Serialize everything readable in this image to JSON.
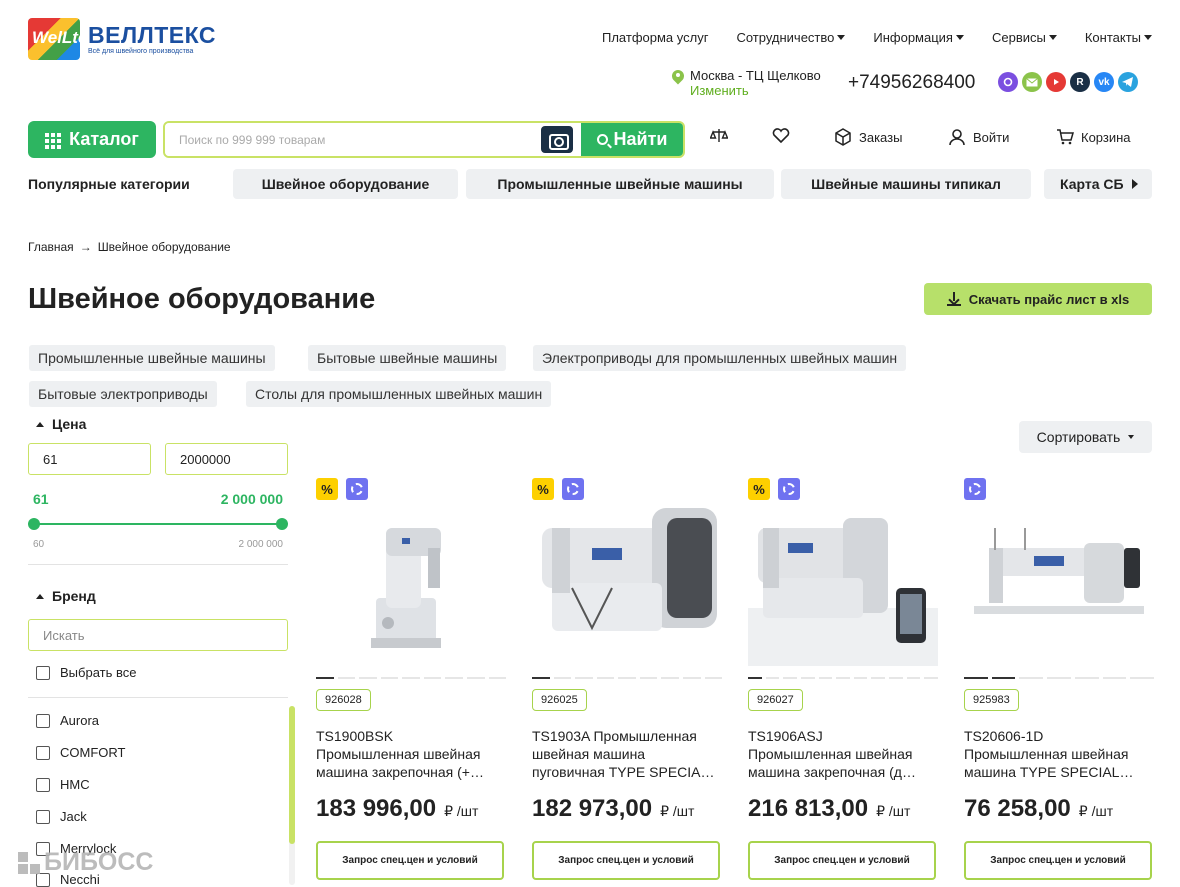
{
  "brand": {
    "logo_mark": "WelLtex",
    "name": "ВЕЛЛТЕКС",
    "tagline": "Всё для швейного производства"
  },
  "topnav": [
    {
      "label": "Платформа услуг",
      "dropdown": false
    },
    {
      "label": "Сотрудничество",
      "dropdown": true
    },
    {
      "label": "Информация",
      "dropdown": true
    },
    {
      "label": "Сервисы",
      "dropdown": true
    },
    {
      "label": "Контакты",
      "dropdown": true
    }
  ],
  "location": {
    "city": "Москва - ТЦ Щелково",
    "change": "Изменить"
  },
  "phone": "+74956268400",
  "socials": [
    {
      "icon": "max-icon",
      "color": "#7b4fe0"
    },
    {
      "icon": "mail-icon",
      "color": "#8bc34a"
    },
    {
      "icon": "youtube-icon",
      "color": "#e53935"
    },
    {
      "icon": "rutube-icon",
      "color": "#1a2f45"
    },
    {
      "icon": "vk-icon",
      "color": "#2787f5"
    },
    {
      "icon": "telegram-icon",
      "color": "#2aa3df"
    }
  ],
  "catalog_button": "Каталог",
  "search": {
    "placeholder": "Поиск по 999 999 товарам",
    "button": "Найти"
  },
  "tools": {
    "compare": "",
    "favorites": "",
    "orders": "Заказы",
    "login": "Войти",
    "cart": "Корзина"
  },
  "popular": {
    "label": "Популярные категории",
    "items": [
      "Швейное оборудование",
      "Промышленные швейные машины",
      "Швейные машины типикал",
      "Карта СБ"
    ]
  },
  "breadcrumb": {
    "home": "Главная",
    "current": "Швейное оборудование"
  },
  "page_title": "Швейное оборудование",
  "download_button": "Скачать прайс лист в xls",
  "subcategories": [
    "Промышленные швейные машины",
    "Бытовые швейные машины",
    "Электроприводы для промышленных швейных машин",
    "Бытовые электроприводы",
    "Столы для промышленных швейных машин"
  ],
  "filters": {
    "price": {
      "title": "Цена",
      "from": "61",
      "to": "2000000",
      "from_display": "61",
      "to_display": "2 000 000",
      "min_label": "60",
      "max_label": "2 000 000",
      "range_fraction": [
        0.0,
        1.0
      ]
    },
    "brand": {
      "title": "Бренд",
      "search_placeholder": "Искать",
      "select_all": "Выбрать все",
      "items": [
        "Aurora",
        "COMFORT",
        "HMC",
        "Jack",
        "Merrylock",
        "Necchi"
      ]
    }
  },
  "sort_button": "Сортировать",
  "products": [
    {
      "sku": "926028",
      "name_lines": [
        "TS1900BSK",
        "Промышленная швейная",
        "машина закрепочная (+…"
      ],
      "price": "183 996,00",
      "unit": "₽ /шт",
      "sale": true,
      "button": "Запрос спец.цен и условий"
    },
    {
      "sku": "926025",
      "name_lines": [
        "TS1903A Промышленная",
        "швейная машина",
        "пуговичная TYPE SPECIA…"
      ],
      "price": "182 973,00",
      "unit": "₽ /шт",
      "sale": true,
      "button": "Запрос спец.цен и условий"
    },
    {
      "sku": "926027",
      "name_lines": [
        "TS1906ASJ",
        "Промышленная швейная",
        "машина закрепочная (д…"
      ],
      "price": "216 813,00",
      "unit": "₽ /шт",
      "sale": true,
      "button": "Запрос спец.цен и условий"
    },
    {
      "sku": "925983",
      "name_lines": [
        "TS20606-1D",
        "Промышленная швейная",
        "машина TYPE SPECIAL…"
      ],
      "price": "76 258,00",
      "unit": "₽ /шт",
      "sale": false,
      "button": "Запрос спец.цен и условий"
    }
  ],
  "watermark": "БИБОСС"
}
